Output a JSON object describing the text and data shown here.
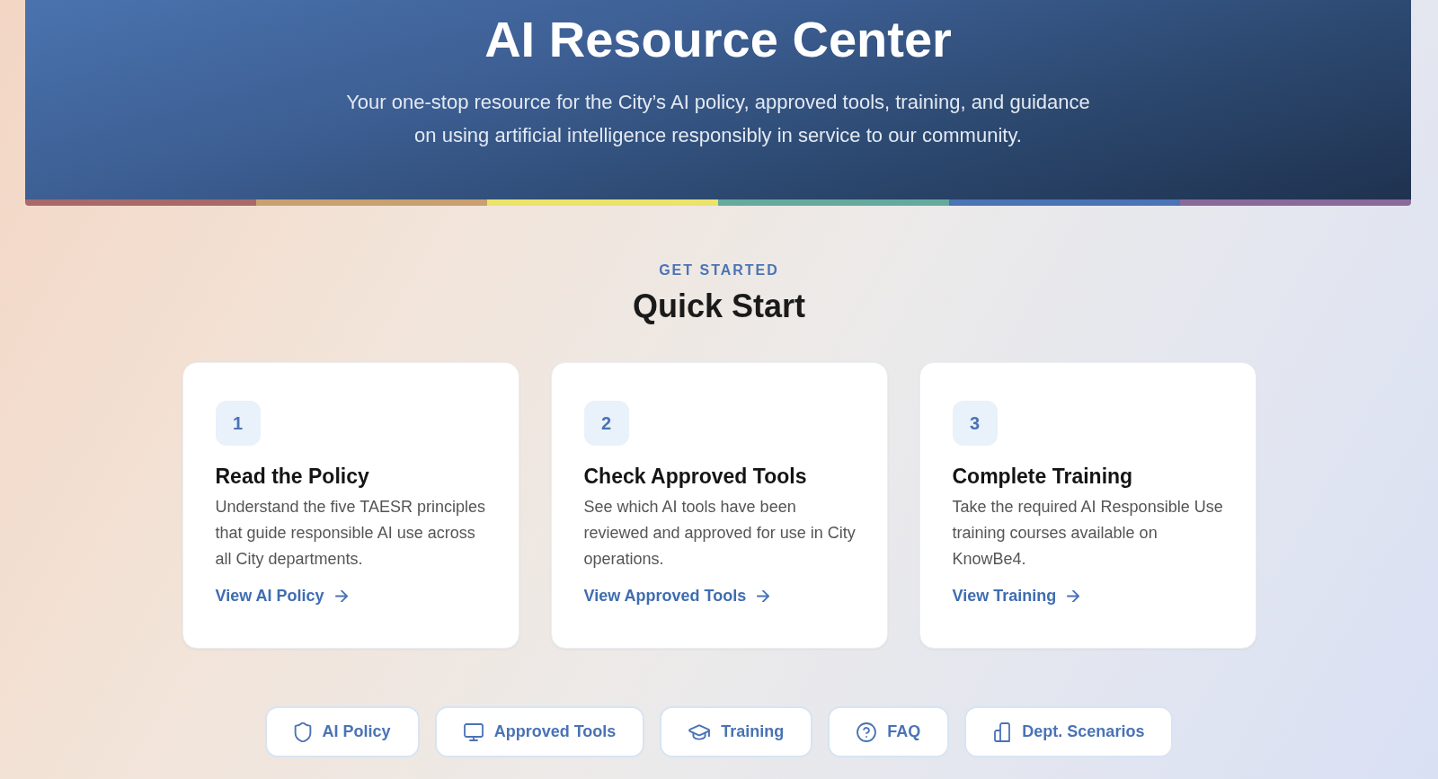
{
  "hero": {
    "title": "AI Resource Center",
    "subtitle": "Your one-stop resource for the City’s AI policy, approved tools, training, and guidance on using artificial intelligence responsibly in service to our community."
  },
  "quick_start": {
    "eyebrow": "GET STARTED",
    "heading": "Quick Start",
    "steps": [
      {
        "number": "1",
        "title": "Read the Policy",
        "description": "Understand the five TAESR principles that guide responsible AI use across all City departments.",
        "link": "View AI Policy"
      },
      {
        "number": "2",
        "title": "Check Approved Tools",
        "description": "See which AI tools have been reviewed and approved for use in City operations.",
        "link": "View Approved Tools"
      },
      {
        "number": "3",
        "title": "Complete Training",
        "description": "Take the required AI Responsible Use training courses available on KnowBe4.",
        "link": "View Training"
      }
    ]
  },
  "nav_buttons": [
    {
      "label": "AI Policy"
    },
    {
      "label": "Approved Tools"
    },
    {
      "label": "Training"
    },
    {
      "label": "FAQ"
    },
    {
      "label": "Dept. Scenarios"
    }
  ]
}
